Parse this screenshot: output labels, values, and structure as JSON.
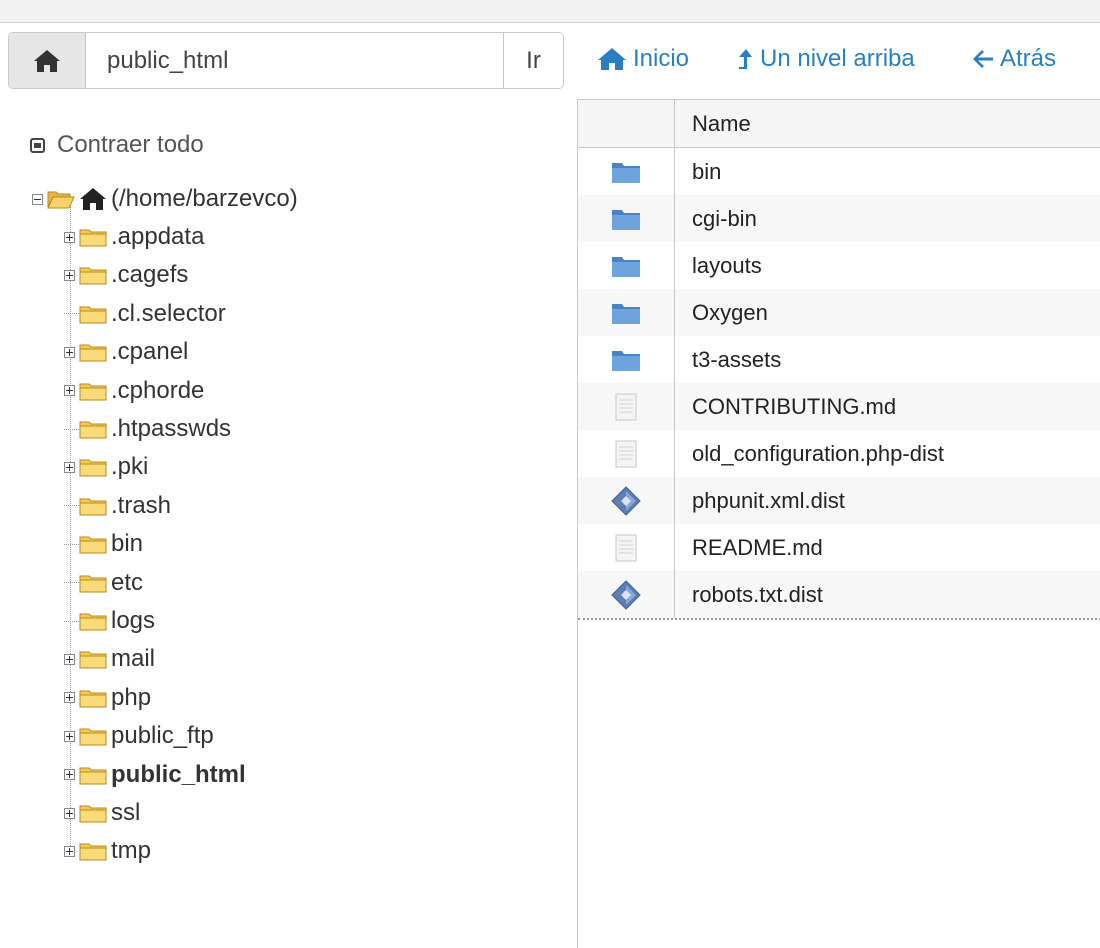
{
  "toolbar": {
    "path_value": "public_html",
    "go_label": "Ir",
    "home_link": "Inicio",
    "up_link": "Un nivel arriba",
    "back_link": "Atrás"
  },
  "sidebar": {
    "collapse_label": "Contraer todo",
    "root_label": "(/home/barzevco)",
    "items": [
      {
        "label": ".appdata",
        "expandable": true
      },
      {
        "label": ".cagefs",
        "expandable": true
      },
      {
        "label": ".cl.selector",
        "expandable": false
      },
      {
        "label": ".cpanel",
        "expandable": true
      },
      {
        "label": ".cphorde",
        "expandable": true
      },
      {
        "label": ".htpasswds",
        "expandable": false
      },
      {
        "label": ".pki",
        "expandable": true
      },
      {
        "label": ".trash",
        "expandable": false
      },
      {
        "label": "bin",
        "expandable": false
      },
      {
        "label": "etc",
        "expandable": false
      },
      {
        "label": "logs",
        "expandable": false
      },
      {
        "label": "mail",
        "expandable": true
      },
      {
        "label": "php",
        "expandable": true
      },
      {
        "label": "public_ftp",
        "expandable": true
      },
      {
        "label": "public_html",
        "expandable": true,
        "current": true
      },
      {
        "label": "ssl",
        "expandable": true
      },
      {
        "label": "tmp",
        "expandable": true
      }
    ]
  },
  "filelist": {
    "header_name": "Name",
    "rows": [
      {
        "name": "bin",
        "type": "folder"
      },
      {
        "name": "cgi-bin",
        "type": "folder"
      },
      {
        "name": "layouts",
        "type": "folder"
      },
      {
        "name": "Oxygen",
        "type": "folder"
      },
      {
        "name": "t3-assets",
        "type": "folder"
      },
      {
        "name": "CONTRIBUTING.md",
        "type": "text"
      },
      {
        "name": "old_configuration.php-dist",
        "type": "text"
      },
      {
        "name": "phpunit.xml.dist",
        "type": "xml"
      },
      {
        "name": "README.md",
        "type": "text"
      },
      {
        "name": "robots.txt.dist",
        "type": "xml"
      }
    ]
  },
  "colors": {
    "link": "#2a7fc0",
    "folder_yellow": "#f3cc57",
    "folder_blue": "#5e95d4"
  }
}
